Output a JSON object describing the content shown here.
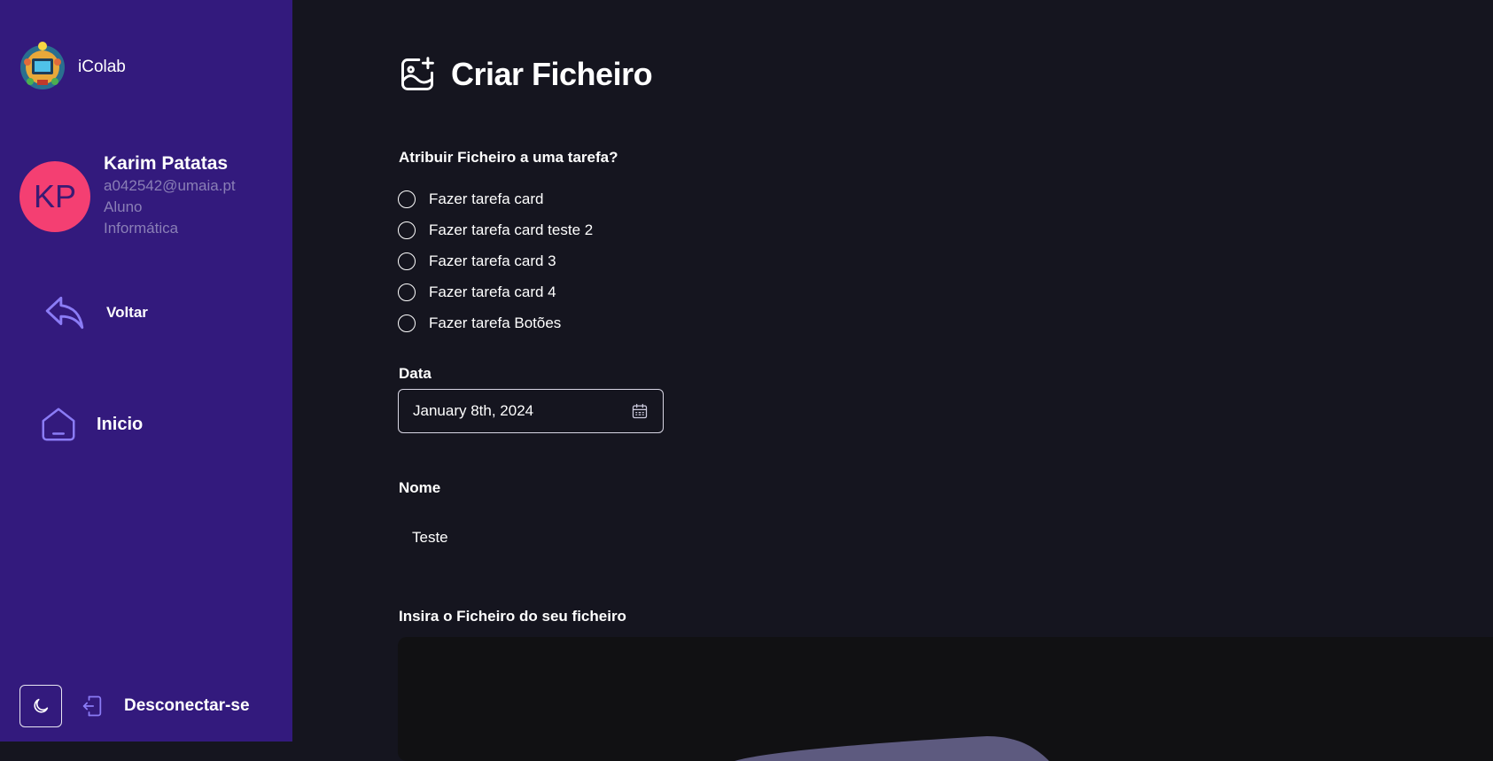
{
  "brand": {
    "name": "iColab"
  },
  "user": {
    "initials": "KP",
    "name": "Karim Patatas",
    "email": "a042542@umaia.pt",
    "role": "Aluno",
    "course": "Informática"
  },
  "nav": {
    "back_label": "Voltar",
    "home_label": "Inicio",
    "logout_label": "Desconectar-se"
  },
  "page": {
    "title": "Criar Ficheiro",
    "assign_label": "Atribuir Ficheiro a uma tarefa?",
    "tasks": [
      "Fazer tarefa card",
      "Fazer tarefa card teste 2",
      "Fazer tarefa card 3",
      "Fazer tarefa card 4",
      "Fazer tarefa Botões"
    ],
    "date_label": "Data",
    "date_value": "January 8th, 2024",
    "name_label": "Nome",
    "name_value": "Teste",
    "file_label": "Insira o Ficheiro do seu ficheiro"
  },
  "colors": {
    "sidebar": "#331a7d",
    "background": "#15151f",
    "avatar": "#f43f72",
    "accent_icon": "#8b7cf6"
  },
  "icons": {
    "logo": "icolab-logo",
    "title": "image-plus-icon",
    "back": "reply-arrow-icon",
    "home": "home-icon",
    "theme": "moon-icon",
    "logout": "logout-icon",
    "calendar": "calendar-icon"
  }
}
